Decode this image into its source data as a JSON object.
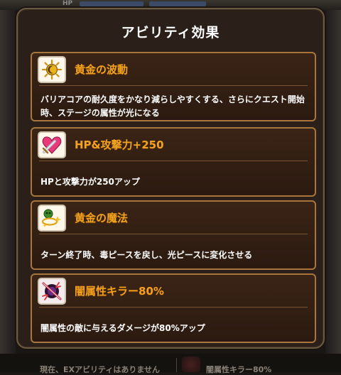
{
  "background": {
    "hp_label": "HP",
    "bottom_left_text": "現在、EXアビリティはありません",
    "bottom_right_text": "闇属性キラー80%"
  },
  "modal": {
    "title": "アビリティ効果",
    "abilities": [
      {
        "name": "黄金の波動",
        "icon": "golden-sun-icon",
        "description": "バリアコアの耐久度をかなり減らしやすくする、さらにクエスト開始時、ステージの属性が光になる"
      },
      {
        "name": "HP&攻撃力+250",
        "icon": "heart-sword-icon",
        "description": "HPと攻撃力が250アップ"
      },
      {
        "name": "黄金の魔法",
        "icon": "golden-magic-icon",
        "description": "ターン終了時、毒ピースを戻し、光ピースに変化させる"
      },
      {
        "name": "闇属性キラー80%",
        "icon": "dark-killer-icon",
        "description": "闇属性の敵に与えるダメージが80%アップ"
      }
    ]
  },
  "colors": {
    "card_border": "#a8763c",
    "ability_name": "#f2a21e",
    "modal_bg": "#2a1f19"
  }
}
